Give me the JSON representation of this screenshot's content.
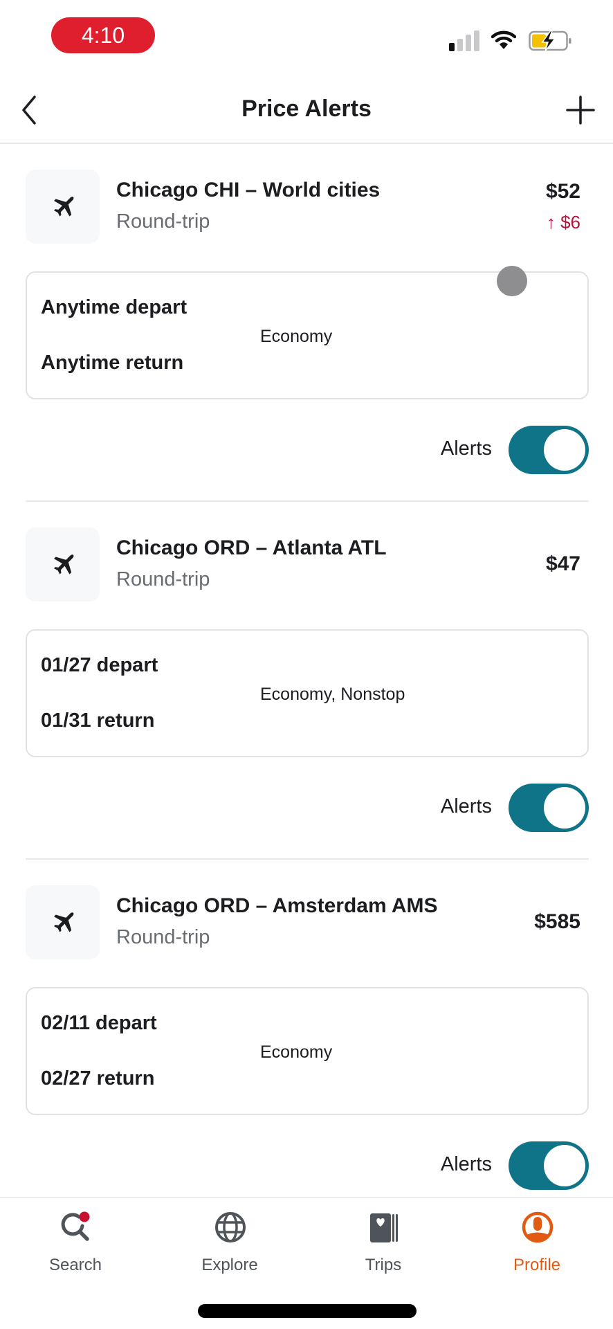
{
  "status_bar": {
    "time": "4:10",
    "signal_bars_active": 1,
    "signal_bars_total": 4,
    "wifi": "connected",
    "battery_level": 0.4,
    "battery_charging": true
  },
  "header": {
    "title": "Price Alerts",
    "back_icon": "chevron-left-icon",
    "add_icon": "plus-icon"
  },
  "alerts": [
    {
      "icon": "airplane-icon",
      "route": "Chicago CHI – World cities",
      "trip_type": "Round-trip",
      "price": "$52",
      "price_change": "↑ $6",
      "depart": "Anytime depart",
      "return": "Anytime return",
      "cabin": "Economy",
      "alerts_label": "Alerts",
      "alerts_enabled": true
    },
    {
      "icon": "airplane-icon",
      "route": "Chicago ORD – Atlanta ATL",
      "trip_type": "Round-trip",
      "price": "$47",
      "price_change": "",
      "depart": "01/27 depart",
      "return": "01/31 return",
      "cabin": "Economy, Nonstop",
      "alerts_label": "Alerts",
      "alerts_enabled": true
    },
    {
      "icon": "airplane-icon",
      "route": "Chicago ORD – Amsterdam AMS",
      "trip_type": "Round-trip",
      "price": "$585",
      "price_change": "",
      "depart": "02/11 depart",
      "return": "02/27 return",
      "cabin": "Economy",
      "alerts_label": "Alerts",
      "alerts_enabled": true
    }
  ],
  "bottom_nav": {
    "items": [
      {
        "label": "Search",
        "icon": "search-icon",
        "active": false,
        "badge": true
      },
      {
        "label": "Explore",
        "icon": "globe-icon",
        "active": false
      },
      {
        "label": "Trips",
        "icon": "trips-icon",
        "active": false
      },
      {
        "label": "Profile",
        "icon": "profile-icon",
        "active": true
      }
    ]
  },
  "colors": {
    "accent_toggle": "#107488",
    "price_increase": "#b3133b",
    "active_nav": "#e25a12",
    "time_pill": "#e01f2e"
  }
}
